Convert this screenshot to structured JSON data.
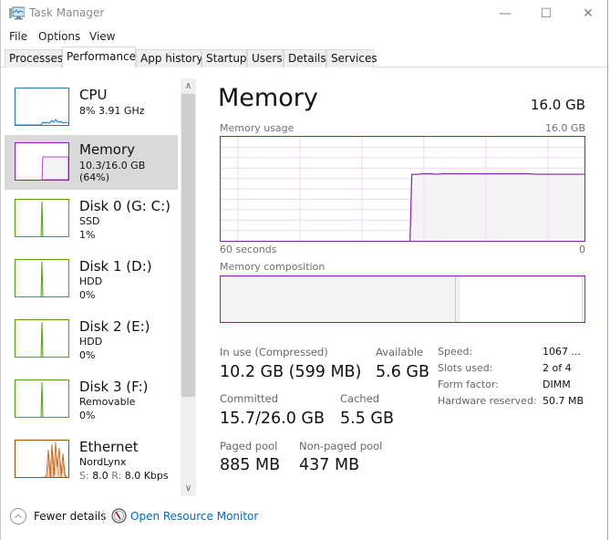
{
  "window": {
    "title": "Task Manager",
    "controls": {
      "minimize": "—",
      "maximize": "☐",
      "close": "✕"
    }
  },
  "menu": [
    "File",
    "Options",
    "View"
  ],
  "tabs": [
    {
      "label": "Processes",
      "active": false
    },
    {
      "label": "Performance",
      "active": true
    },
    {
      "label": "App history",
      "active": false
    },
    {
      "label": "Startup",
      "active": false
    },
    {
      "label": "Users",
      "active": false
    },
    {
      "label": "Details",
      "active": false
    },
    {
      "label": "Services",
      "active": false
    }
  ],
  "sidebar": {
    "items": [
      {
        "title": "CPU",
        "line1": "8% 3.91 GHz",
        "line2": "",
        "color": "#1e7bc0",
        "selected": false
      },
      {
        "title": "Memory",
        "line1": "10.3/16.0 GB (64%)",
        "line2": "",
        "color": "#8b1eaf",
        "selected": true
      },
      {
        "title": "Disk 0 (G: C:)",
        "line1": "SSD",
        "line2": "1%",
        "color": "#4da60c",
        "selected": false
      },
      {
        "title": "Disk 1 (D:)",
        "line1": "HDD",
        "line2": "0%",
        "color": "#4da60c",
        "selected": false
      },
      {
        "title": "Disk 2 (E:)",
        "line1": "HDD",
        "line2": "0%",
        "color": "#4da60c",
        "selected": false
      },
      {
        "title": "Disk 3 (F:)",
        "line1": "Removable",
        "line2": "0%",
        "color": "#4da60c",
        "selected": false
      },
      {
        "title": "Ethernet",
        "line1": "NordLynx",
        "line2_send_label": "S:",
        "line2_send": "8.0",
        "line2_recv_label": "R:",
        "line2_recv": "8.0 Kbps",
        "color": "#a74f01",
        "selected": false
      }
    ]
  },
  "main": {
    "title": "Memory",
    "total": "16.0 GB",
    "usage_label": "Memory usage",
    "usage_max": "16.0 GB",
    "axis_left": "60 seconds",
    "axis_right": "0",
    "usage_history_fraction": [
      0,
      0,
      0,
      0,
      0,
      0,
      0,
      0,
      0,
      0,
      0,
      0,
      0,
      0,
      0,
      0,
      0,
      0,
      0,
      0,
      0,
      0,
      0,
      0,
      0,
      0,
      0,
      0,
      0,
      0,
      0,
      0.64,
      0.64,
      0.645,
      0.645,
      0.64,
      0.645,
      0.645,
      0.645,
      0.645,
      0.645,
      0.645,
      0.645,
      0.645,
      0.645,
      0.645,
      0.645,
      0.645,
      0.645,
      0.645,
      0.645,
      0.64,
      0.64,
      0.64,
      0.64,
      0.64,
      0.64,
      0.64,
      0.64,
      0.64
    ],
    "composition_label": "Memory composition",
    "composition": {
      "in_use_fraction": 0.645,
      "modified_fraction": 0.01,
      "standby_fraction": 0.34,
      "free_fraction": 0.005
    },
    "stats": {
      "in_use_label": "In use (Compressed)",
      "in_use": "10.2 GB (599 MB)",
      "available_label": "Available",
      "available": "5.6 GB",
      "committed_label": "Committed",
      "committed": "15.7/26.0 GB",
      "cached_label": "Cached",
      "cached": "5.5 GB",
      "paged_label": "Paged pool",
      "paged": "885 MB",
      "nonpaged_label": "Non-paged pool",
      "nonpaged": "437 MB"
    },
    "details": [
      {
        "key": "Speed:",
        "value": "1067 ..."
      },
      {
        "key": "Slots used:",
        "value": "2 of 4"
      },
      {
        "key": "Form factor:",
        "value": "DIMM"
      },
      {
        "key": "Hardware reserved:",
        "value": "50.7 MB"
      }
    ]
  },
  "footer": {
    "fewer_details": "Fewer details",
    "open_resource_monitor": "Open Resource Monitor"
  },
  "colors": {
    "memory": "#8b1eaf",
    "cpu": "#1e7bc0",
    "disk": "#4da60c",
    "ethernet": "#a74f01",
    "link": "#0066cc"
  }
}
